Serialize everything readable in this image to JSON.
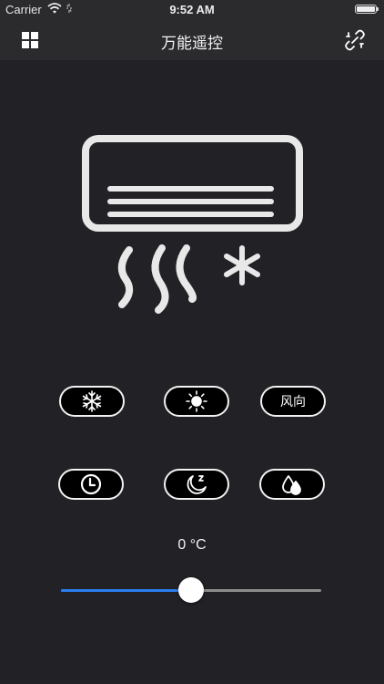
{
  "status_bar": {
    "carrier": "Carrier",
    "time": "9:52 AM"
  },
  "nav": {
    "title": "万能遥控",
    "left_icon": "grid-menu-icon",
    "right_icon": "unlink-icon"
  },
  "buttons": [
    {
      "icon": "snowflake-icon",
      "text": ""
    },
    {
      "icon": "sun-icon",
      "text": ""
    },
    {
      "icon": "",
      "text": "风向"
    },
    {
      "icon": "clock-icon",
      "text": ""
    },
    {
      "icon": "sleep-moon-icon",
      "text": ""
    },
    {
      "icon": "water-drops-icon",
      "text": ""
    }
  ],
  "temperature": {
    "display": "0 °C"
  },
  "slider": {
    "value_fraction": 0.5
  },
  "colors": {
    "background": "#222226",
    "bar": "#2b2b2e",
    "accent": "#2b7df0",
    "icon": "#e8e8e8"
  }
}
